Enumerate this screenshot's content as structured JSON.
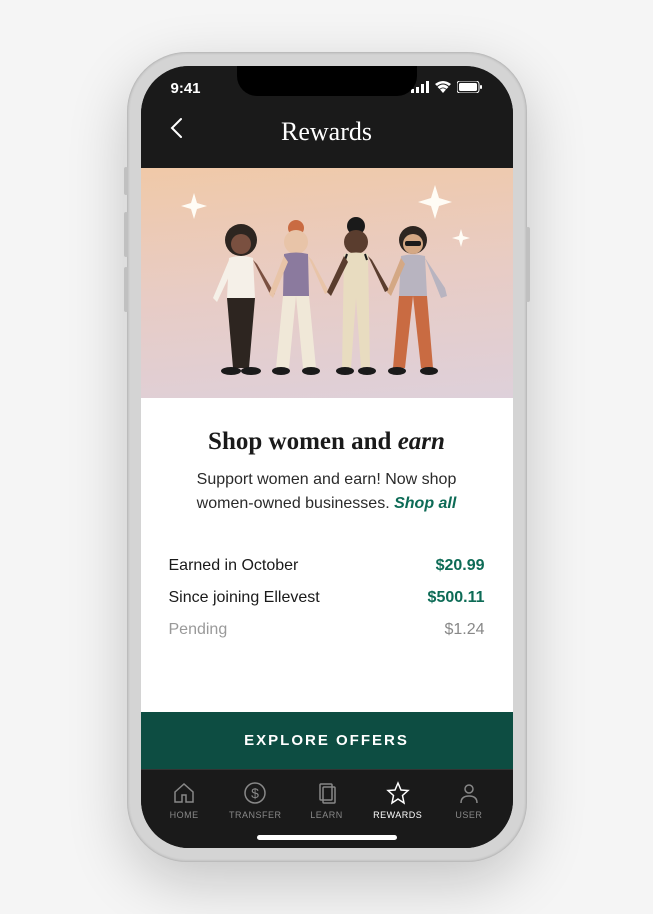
{
  "statusBar": {
    "time": "9:41"
  },
  "header": {
    "title": "Rewards"
  },
  "card": {
    "headline_prefix": "Shop women and ",
    "headline_em": "earn",
    "subtitle_text": "Support women and earn! Now shop women-owned businesses. ",
    "shop_all": "Shop all"
  },
  "stats": {
    "earned_month_label": "Earned in October",
    "earned_month_value": "$20.99",
    "since_label": "Since joining Ellevest",
    "since_value": "$500.11",
    "pending_label": "Pending",
    "pending_value": "$1.24"
  },
  "cta": "EXPLORE OFFERS",
  "tabs": {
    "home": "HOME",
    "transfer": "TRANSFER",
    "learn": "LEARN",
    "rewards": "REWARDS",
    "user": "USER"
  }
}
